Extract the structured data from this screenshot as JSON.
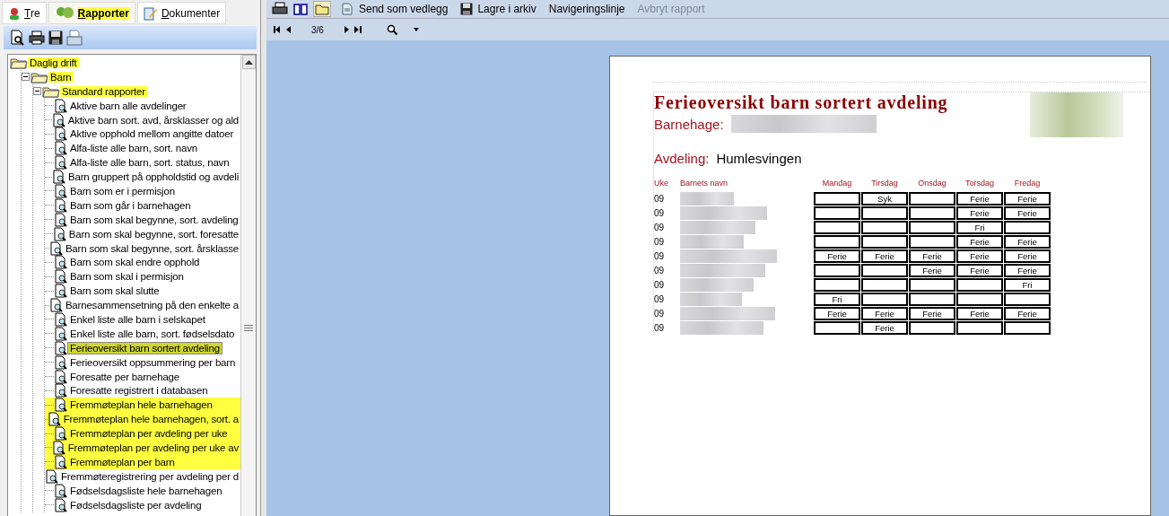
{
  "left_panel": {
    "tabs": [
      {
        "label": "Tre",
        "selected": false
      },
      {
        "label": "Rapporter",
        "selected": true
      },
      {
        "label": "Dokumenter",
        "selected": false
      }
    ],
    "tree": [
      {
        "label": "Daglig drift",
        "kind": "folder",
        "expanded": true,
        "highlighted": true,
        "selected": false,
        "children": [
          {
            "label": "Barn",
            "kind": "folder",
            "expanded": true,
            "highlighted": true,
            "selected": false,
            "children": [
              {
                "label": "Standard rapporter",
                "kind": "folder",
                "expanded": true,
                "highlighted": true,
                "selected": false,
                "children": [
                  {
                    "label": "Aktive barn alle avdelinger",
                    "kind": "report",
                    "highlighted": false,
                    "selected": false
                  },
                  {
                    "label": "Aktive barn sort. avd, årsklasser og ald",
                    "kind": "report",
                    "highlighted": false,
                    "selected": false
                  },
                  {
                    "label": "Aktive opphold mellom angitte datoer",
                    "kind": "report",
                    "highlighted": false,
                    "selected": false
                  },
                  {
                    "label": "Alfa-liste alle barn, sort. navn",
                    "kind": "report",
                    "highlighted": false,
                    "selected": false
                  },
                  {
                    "label": "Alfa-liste alle barn, sort. status, navn",
                    "kind": "report",
                    "highlighted": false,
                    "selected": false
                  },
                  {
                    "label": "Barn gruppert på oppholdstid og avdeli",
                    "kind": "report",
                    "highlighted": false,
                    "selected": false
                  },
                  {
                    "label": "Barn som er i permisjon",
                    "kind": "report",
                    "highlighted": false,
                    "selected": false
                  },
                  {
                    "label": "Barn som går i barnehagen",
                    "kind": "report",
                    "highlighted": false,
                    "selected": false
                  },
                  {
                    "label": "Barn som skal begynne, sort. avdeling",
                    "kind": "report",
                    "highlighted": false,
                    "selected": false
                  },
                  {
                    "label": "Barn som skal begynne, sort. foresatte",
                    "kind": "report",
                    "highlighted": false,
                    "selected": false
                  },
                  {
                    "label": "Barn som skal begynne, sort. årsklasse",
                    "kind": "report",
                    "highlighted": false,
                    "selected": false
                  },
                  {
                    "label": "Barn som skal endre opphold",
                    "kind": "report",
                    "highlighted": false,
                    "selected": false
                  },
                  {
                    "label": "Barn som skal i permisjon",
                    "kind": "report",
                    "highlighted": false,
                    "selected": false
                  },
                  {
                    "label": "Barn som skal slutte",
                    "kind": "report",
                    "highlighted": false,
                    "selected": false
                  },
                  {
                    "label": "Barnesammensetning på den enkelte a",
                    "kind": "report",
                    "highlighted": false,
                    "selected": false
                  },
                  {
                    "label": "Enkel liste alle barn i selskapet",
                    "kind": "report",
                    "highlighted": false,
                    "selected": false
                  },
                  {
                    "label": "Enkel liste alle barn, sort. fødselsdato",
                    "kind": "report",
                    "highlighted": false,
                    "selected": false
                  },
                  {
                    "label": "Ferieoversikt barn sortert avdeling",
                    "kind": "report",
                    "highlighted": true,
                    "selected": true
                  },
                  {
                    "label": "Ferieoversikt oppsummering per barn",
                    "kind": "report",
                    "highlighted": false,
                    "selected": false
                  },
                  {
                    "label": "Foresatte per barnehage",
                    "kind": "report",
                    "highlighted": false,
                    "selected": false
                  },
                  {
                    "label": "Foresatte registrert i databasen",
                    "kind": "report",
                    "highlighted": false,
                    "selected": false
                  },
                  {
                    "label": "Fremmøteplan hele barnehagen",
                    "kind": "report",
                    "highlighted": true,
                    "selected": false
                  },
                  {
                    "label": "Fremmøteplan hele barnehagen, sort. a",
                    "kind": "report",
                    "highlighted": true,
                    "selected": false
                  },
                  {
                    "label": "Fremmøteplan per avdeling per uke",
                    "kind": "report",
                    "highlighted": true,
                    "selected": false
                  },
                  {
                    "label": "Fremmøteplan per avdeling per uke av",
                    "kind": "report",
                    "highlighted": true,
                    "selected": false
                  },
                  {
                    "label": "Fremmøteplan per barn",
                    "kind": "report",
                    "highlighted": true,
                    "selected": false
                  },
                  {
                    "label": "Fremmøteregistrering per avdeling per d",
                    "kind": "report",
                    "highlighted": false,
                    "selected": false
                  },
                  {
                    "label": "Fødselsdagsliste hele barnehagen",
                    "kind": "report",
                    "highlighted": false,
                    "selected": false
                  },
                  {
                    "label": "Fødselsdagsliste per avdeling",
                    "kind": "report",
                    "highlighted": false,
                    "selected": false
                  }
                ]
              }
            ]
          }
        ]
      }
    ]
  },
  "toolbar": {
    "buttons": [
      {
        "label": "Send som vedlegg",
        "disabled": false
      },
      {
        "label": "Lagre i arkiv",
        "disabled": false
      },
      {
        "label": "Navigeringslinje",
        "disabled": false
      },
      {
        "label": "Avbryt rapport",
        "disabled": true
      }
    ]
  },
  "navigation": {
    "page": "3/6"
  },
  "report": {
    "title": "Ferieoversikt barn sortert avdeling",
    "kindergarten_label": "Barnehage:",
    "department_label": "Avdeling:",
    "department": "Humlesvingen",
    "columns": [
      "Uke",
      "Barnets navn",
      "Mandag",
      "Tirsdag",
      "Onsdag",
      "Torsdag",
      "Fredag"
    ],
    "rows": [
      {
        "week": "09",
        "days": {
          "tue": "Syk",
          "thu": "Ferie",
          "fri": "Ferie"
        }
      },
      {
        "week": "09",
        "days": {
          "thu": "Ferie",
          "fri": "Ferie"
        }
      },
      {
        "week": "09",
        "days": {
          "thu": "Fri"
        }
      },
      {
        "week": "09",
        "days": {
          "thu": "Ferie",
          "fri": "Ferie"
        }
      },
      {
        "week": "09",
        "days": {
          "mon": "Ferie",
          "tue": "Ferie",
          "wed": "Ferie",
          "thu": "Ferie",
          "fri": "Ferie"
        }
      },
      {
        "week": "09",
        "days": {
          "wed": "Ferie",
          "thu": "Ferie",
          "fri": "Ferie"
        }
      },
      {
        "week": "09",
        "days": {
          "fri": "Fri"
        }
      },
      {
        "week": "09",
        "days": {
          "mon": "Fri"
        }
      },
      {
        "week": "09",
        "days": {
          "mon": "Ferie",
          "tue": "Ferie",
          "wed": "Ferie",
          "thu": "Ferie",
          "fri": "Ferie"
        }
      },
      {
        "week": "09",
        "days": {
          "tue": "Ferie"
        }
      }
    ]
  }
}
